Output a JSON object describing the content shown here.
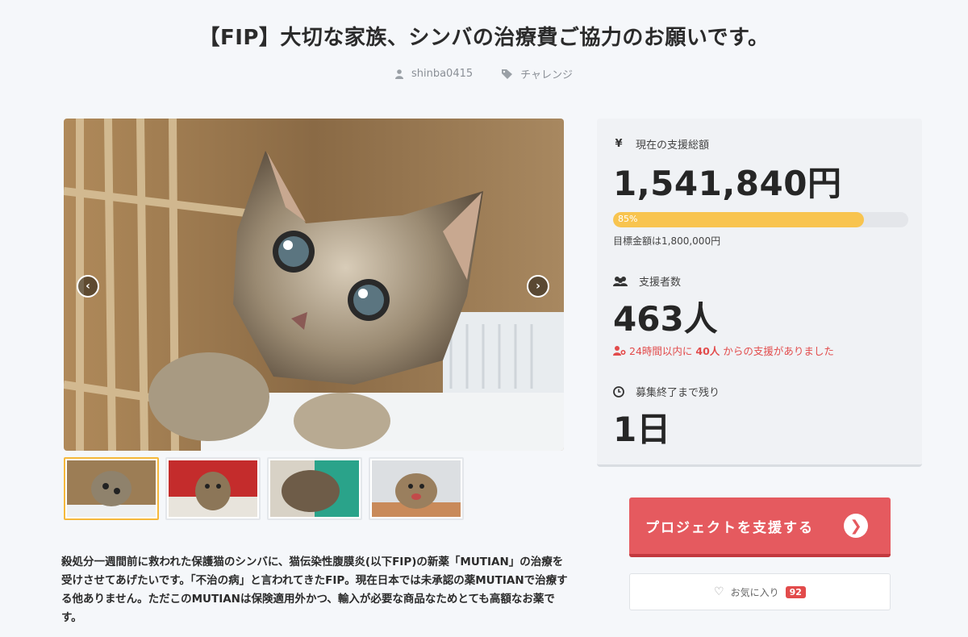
{
  "project": {
    "title": "【FIP】大切な家族、シンバの治療費ご協力のお願いです。",
    "owner": "shinba0415",
    "category": "チャレンジ"
  },
  "gallery": {
    "prev_label": "‹",
    "next_label": "›",
    "thumb_count": 4,
    "active_thumb": 0
  },
  "stats": {
    "total_label": "現在の支援総額",
    "total_amount": "1,541,840円",
    "progress_percent": 85,
    "progress_label": "85%",
    "goal_text": "目標金額は1,800,000円",
    "supporters_label": "支援者数",
    "supporters_count": "463人",
    "recent_prefix": "24時間以内に",
    "recent_count": "40人",
    "recent_suffix": "からの支援がありました",
    "remaining_label": "募集終了まで残り",
    "remaining_value": "1日"
  },
  "actions": {
    "support_label": "プロジェクトを支援する",
    "favorite_label": "お気に入り",
    "favorite_count": "92"
  },
  "description": "殺処分一週間前に救われた保護猫のシンバに、猫伝染性腹膜炎(以下FIP)の新薬「MUTIAN」の治療を受けさせてあげたいです。「不治の病」と言われてきたFIP。現在日本では未承認の薬MUTIANで治療する他ありません。ただこのMUTIANは保険適用外かつ、輸入が必要な商品なためとても高額なお薬です。",
  "colors": {
    "accent_red": "#e55a5f",
    "progress_yellow": "#f8c44f",
    "alert_red": "#e24b4b"
  }
}
